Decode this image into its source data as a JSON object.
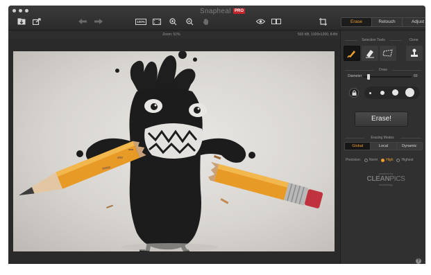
{
  "window": {
    "title": "Snapheal",
    "edition_badge": "PRO"
  },
  "toolbar": {
    "left_icons": [
      "import-icon",
      "share-icon"
    ],
    "history_icons": [
      "undo-icon",
      "redo-icon"
    ],
    "view_icons": [
      "actual-size-icon",
      "fit-screen-icon",
      "zoom-in-icon",
      "zoom-out-icon",
      "pan-hand-icon"
    ],
    "actual_size_label": "100%",
    "right_icons": [
      "preview-eye-icon",
      "compare-icon",
      "crop-icon"
    ]
  },
  "panel_tabs": [
    {
      "label": "Erase",
      "active": true
    },
    {
      "label": "Retouch",
      "active": false
    },
    {
      "label": "Adjust",
      "active": false
    }
  ],
  "status": {
    "zoom": "Zoom: 51%",
    "file_info": "503 KB, 1920x1200, 8-Bit"
  },
  "erase_panel": {
    "selection_tools_label": "Selection Tools",
    "clone_label": "Clone",
    "draw_label": "Draw",
    "diameter_label": "Diameter",
    "diameter_value": "60",
    "diameter_fraction": 0.12,
    "erase_button": "Erase!",
    "erasing_modes_label": "Erasing Modes",
    "modes": [
      {
        "label": "Global",
        "active": true
      },
      {
        "label": "Local",
        "active": false
      },
      {
        "label": "Dynamic",
        "active": false
      }
    ],
    "precision_label": "Precision:",
    "precision_options": [
      {
        "label": "Norm",
        "selected": false
      },
      {
        "label": "High",
        "selected": true
      },
      {
        "label": "Highest",
        "selected": false
      }
    ]
  },
  "brand": {
    "tagline": "powered by",
    "name_bold": "CLEAN",
    "name_thin": "PICS",
    "subline": "technology"
  },
  "colors": {
    "accent": "#f0a030",
    "panel_bg": "#303030",
    "window_bg": "#2a2a2a"
  }
}
